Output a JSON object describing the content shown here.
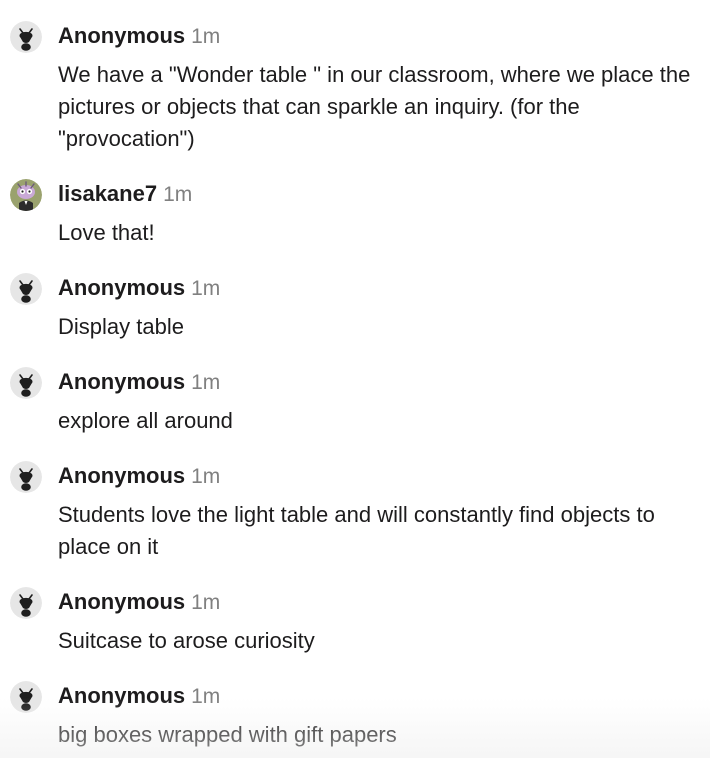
{
  "colors": {
    "author": "#1d1c1d",
    "timestamp": "#808080",
    "anon_avatar_bg": "#e6e6e6",
    "anon_avatar_fg": "#1f1f1f",
    "user_avatar_bg": "#9aa26e"
  },
  "messages": [
    {
      "author": "Anonymous",
      "time": "1m",
      "avatar_icon": "anonymous-ant-icon",
      "text": "We have a \"Wonder table \" in our classroom, where we place the pictures or objects that can sparkle an inquiry. (for the \"provocation\")"
    },
    {
      "author": "lisakane7",
      "time": "1m",
      "avatar_icon": "user-profile-photo",
      "text": "Love that!"
    },
    {
      "author": "Anonymous",
      "time": "1m",
      "avatar_icon": "anonymous-ant-icon",
      "text": "Display table"
    },
    {
      "author": "Anonymous",
      "time": "1m",
      "avatar_icon": "anonymous-ant-icon",
      "text": "explore all around"
    },
    {
      "author": "Anonymous",
      "time": "1m",
      "avatar_icon": "anonymous-ant-icon",
      "text": "Students love the light table and will constantly find objects to place on it"
    },
    {
      "author": "Anonymous",
      "time": "1m",
      "avatar_icon": "anonymous-ant-icon",
      "text": "Suitcase to arose curiosity"
    },
    {
      "author": "Anonymous",
      "time": "1m",
      "avatar_icon": "anonymous-ant-icon",
      "text": "big boxes wrapped with gift papers"
    }
  ]
}
